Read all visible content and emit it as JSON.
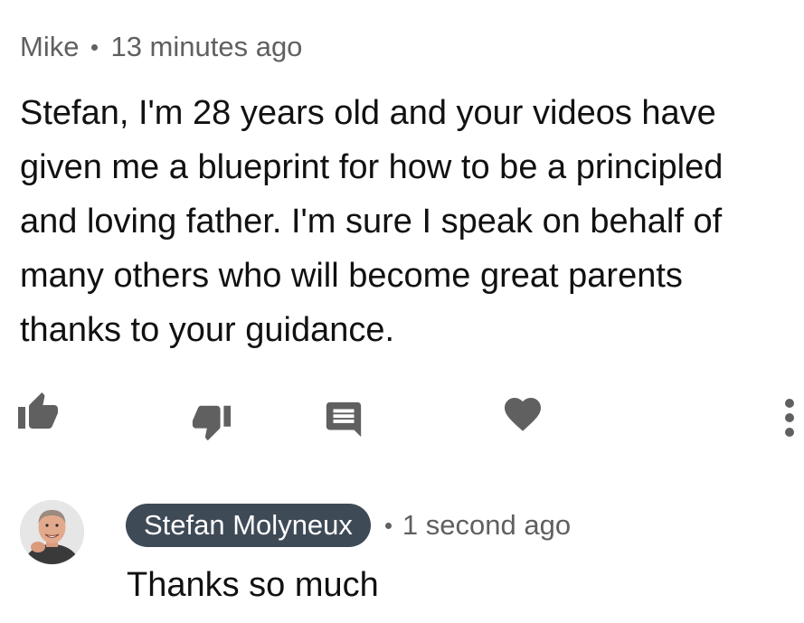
{
  "comment": {
    "author": "Mike",
    "time": "13 minutes ago",
    "text": "Stefan, I'm 28 years old and your videos have\ngiven me a blueprint for how to be a principled\nand loving father. I'm sure I speak on behalf of\nmany others who will become great parents\nthanks to your guidance."
  },
  "actions": {
    "like_icon": "thumbs-up-icon",
    "dislike_icon": "thumbs-down-icon",
    "reply_icon": "reply-comment-icon",
    "heart_icon": "heart-icon",
    "more_icon": "more-vertical-icon"
  },
  "reply": {
    "author": "Stefan Molyneux",
    "time": "1 second ago",
    "text": "Thanks so much"
  },
  "colors": {
    "icon": "#606060",
    "meta_text": "#606060",
    "body_text": "#111111",
    "author_chip_bg": "#3f4a57",
    "author_chip_text": "#ffffff"
  }
}
